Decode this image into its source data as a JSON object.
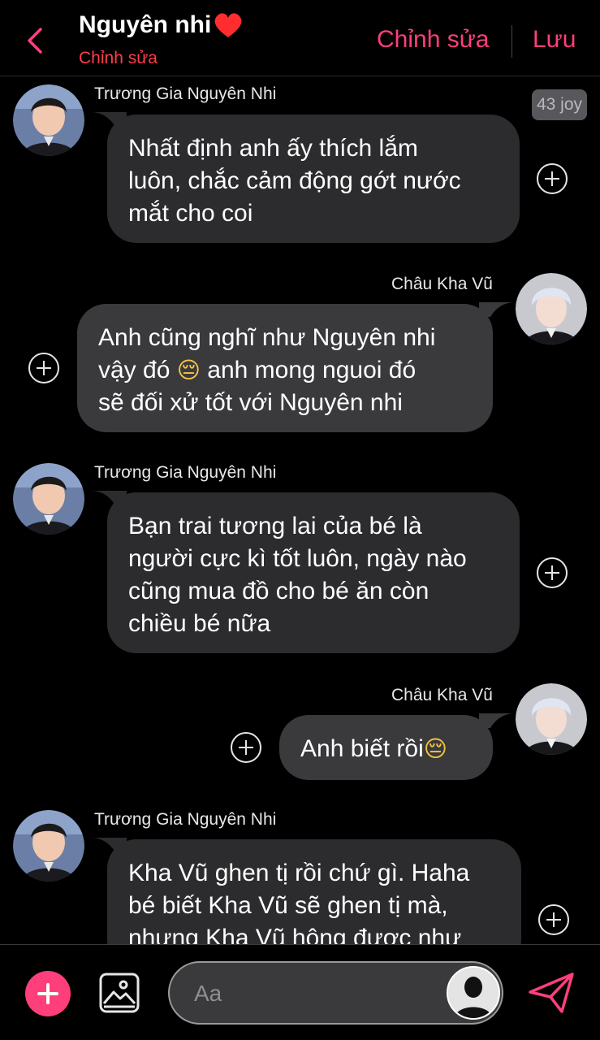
{
  "header": {
    "title": "Nguyên nhi",
    "heart_icon": "red-heart",
    "subtitle": "Chỉnh sửa",
    "edit_label": "Chỉnh sửa",
    "save_label": "Lưu"
  },
  "badge": {
    "text": "43 joy"
  },
  "messages": [
    {
      "side": "left",
      "sender": "Trương Gia Nguyên Nhi",
      "lines": [
        "Nhất định anh ấy thích lắm",
        "luôn, chắc cảm động gớt nước",
        "mắt cho coi"
      ]
    },
    {
      "side": "right",
      "sender": "Châu Kha Vũ",
      "line1": "Anh cũng nghĩ như Nguyên nhi",
      "line2_pre": "vậy đó ",
      "line2_emoji": "😔",
      "line2_post": " anh mong nguoi đó",
      "line3": "sẽ đối xử tốt với Nguyên nhi"
    },
    {
      "side": "left",
      "sender": "Trương Gia Nguyên Nhi",
      "lines": [
        "Bạn trai tương lai của bé là",
        "người cực kì tốt luôn, ngày nào",
        "cũng mua đồ cho bé ăn còn",
        "chiều bé nữa"
      ]
    },
    {
      "side": "right",
      "sender": "Châu Kha Vũ",
      "text": "Anh biết rồi",
      "emoji": "😔"
    },
    {
      "side": "left",
      "sender": "Trương Gia Nguyên Nhi",
      "lines": [
        "Kha Vũ ghen tị rồi chứ gì. Haha",
        "bé biết Kha Vũ sẽ ghen tị mà,",
        "nhưng Kha Vũ hông được như"
      ]
    }
  ],
  "composer": {
    "placeholder": "Aa",
    "add_icon": "plus-icon",
    "gallery_icon": "image-icon",
    "profile_icon": "person-silhouette-icon",
    "send_icon": "paper-plane-icon"
  },
  "colors": {
    "accent": "#ff3f7c",
    "heart": "#ff2d2d",
    "bubble_left": "#2c2c2e",
    "bubble_right": "#3a3a3c",
    "background": "#000000"
  }
}
